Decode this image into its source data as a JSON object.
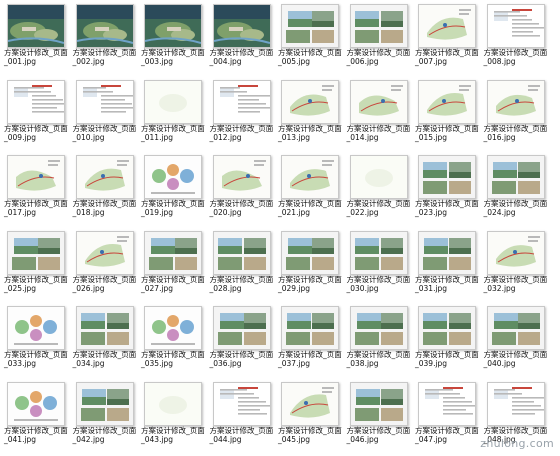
{
  "window": {
    "title": ""
  },
  "thumbnails": [
    {
      "caption": "方案设计修改_页面_001.jpg",
      "style": "aerial"
    },
    {
      "caption": "方案设计修改_页面_002.jpg",
      "style": "aerial"
    },
    {
      "caption": "方案设计修改_页面_003.jpg",
      "style": "aerial"
    },
    {
      "caption": "方案设计修改_页面_004.jpg",
      "style": "aerial"
    },
    {
      "caption": "方案设计修改_页面_005.jpg",
      "style": "photo"
    },
    {
      "caption": "方案设计修改_页面_006.jpg",
      "style": "photo"
    },
    {
      "caption": "方案设计修改_页面_007.jpg",
      "style": "map"
    },
    {
      "caption": "方案设计修改_页面_008.jpg",
      "style": "text"
    },
    {
      "caption": "方案设计修改_页面_009.jpg",
      "style": "text"
    },
    {
      "caption": "方案设计修改_页面_010.jpg",
      "style": "text"
    },
    {
      "caption": "方案设计修改_页面_011.jpg",
      "style": "blank"
    },
    {
      "caption": "方案设计修改_页面_012.jpg",
      "style": "text"
    },
    {
      "caption": "方案设计修改_页面_013.jpg",
      "style": "map"
    },
    {
      "caption": "方案设计修改_页面_014.jpg",
      "style": "map"
    },
    {
      "caption": "方案设计修改_页面_015.jpg",
      "style": "map"
    },
    {
      "caption": "方案设计修改_页面_016.jpg",
      "style": "map"
    },
    {
      "caption": "方案设计修改_页面_017.jpg",
      "style": "map"
    },
    {
      "caption": "方案设计修改_页面_018.jpg",
      "style": "map"
    },
    {
      "caption": "方案设计修改_页面_019.jpg",
      "style": "diagram"
    },
    {
      "caption": "方案设计修改_页面_020.jpg",
      "style": "map"
    },
    {
      "caption": "方案设计修改_页面_021.jpg",
      "style": "map"
    },
    {
      "caption": "方案设计修改_页面_022.jpg",
      "style": "blank"
    },
    {
      "caption": "方案设计修改_页面_023.jpg",
      "style": "photo"
    },
    {
      "caption": "方案设计修改_页面_024.jpg",
      "style": "photo"
    },
    {
      "caption": "方案设计修改_页面_025.jpg",
      "style": "photo"
    },
    {
      "caption": "方案设计修改_页面_026.jpg",
      "style": "map"
    },
    {
      "caption": "方案设计修改_页面_027.jpg",
      "style": "photo"
    },
    {
      "caption": "方案设计修改_页面_028.jpg",
      "style": "photo"
    },
    {
      "caption": "方案设计修改_页面_029.jpg",
      "style": "photo"
    },
    {
      "caption": "方案设计修改_页面_030.jpg",
      "style": "photo"
    },
    {
      "caption": "方案设计修改_页面_031.jpg",
      "style": "photo"
    },
    {
      "caption": "方案设计修改_页面_032.jpg",
      "style": "map"
    },
    {
      "caption": "方案设计修改_页面_033.jpg",
      "style": "diagram"
    },
    {
      "caption": "方案设计修改_页面_034.jpg",
      "style": "photo"
    },
    {
      "caption": "方案设计修改_页面_035.jpg",
      "style": "diagram"
    },
    {
      "caption": "方案设计修改_页面_036.jpg",
      "style": "photo"
    },
    {
      "caption": "方案设计修改_页面_037.jpg",
      "style": "photo"
    },
    {
      "caption": "方案设计修改_页面_038.jpg",
      "style": "photo"
    },
    {
      "caption": "方案设计修改_页面_039.jpg",
      "style": "photo"
    },
    {
      "caption": "方案设计修改_页面_040.jpg",
      "style": "photo"
    },
    {
      "caption": "方案设计修改_页面_041.jpg",
      "style": "diagram"
    },
    {
      "caption": "方案设计修改_页面_042.jpg",
      "style": "photo"
    },
    {
      "caption": "方案设计修改_页面_043.jpg",
      "style": "blank"
    },
    {
      "caption": "方案设计修改_页面_044.jpg",
      "style": "text"
    },
    {
      "caption": "方案设计修改_页面_045.jpg",
      "style": "map"
    },
    {
      "caption": "方案设计修改_页面_046.jpg",
      "style": "photo"
    },
    {
      "caption": "方案设计修改_页面_047.jpg",
      "style": "text"
    },
    {
      "caption": "方案设计修改_页面_048.jpg",
      "style": "text"
    }
  ],
  "watermark": {
    "text": "zhulong.com"
  },
  "colors": {
    "photo_green": "#5f8d63",
    "photo_sky": "#9cc0d8",
    "map_green": "#c8dcb4",
    "text_line": "#b9b9b9",
    "accent_red": "#c8463c",
    "accent_blue": "#3a6fb0"
  }
}
